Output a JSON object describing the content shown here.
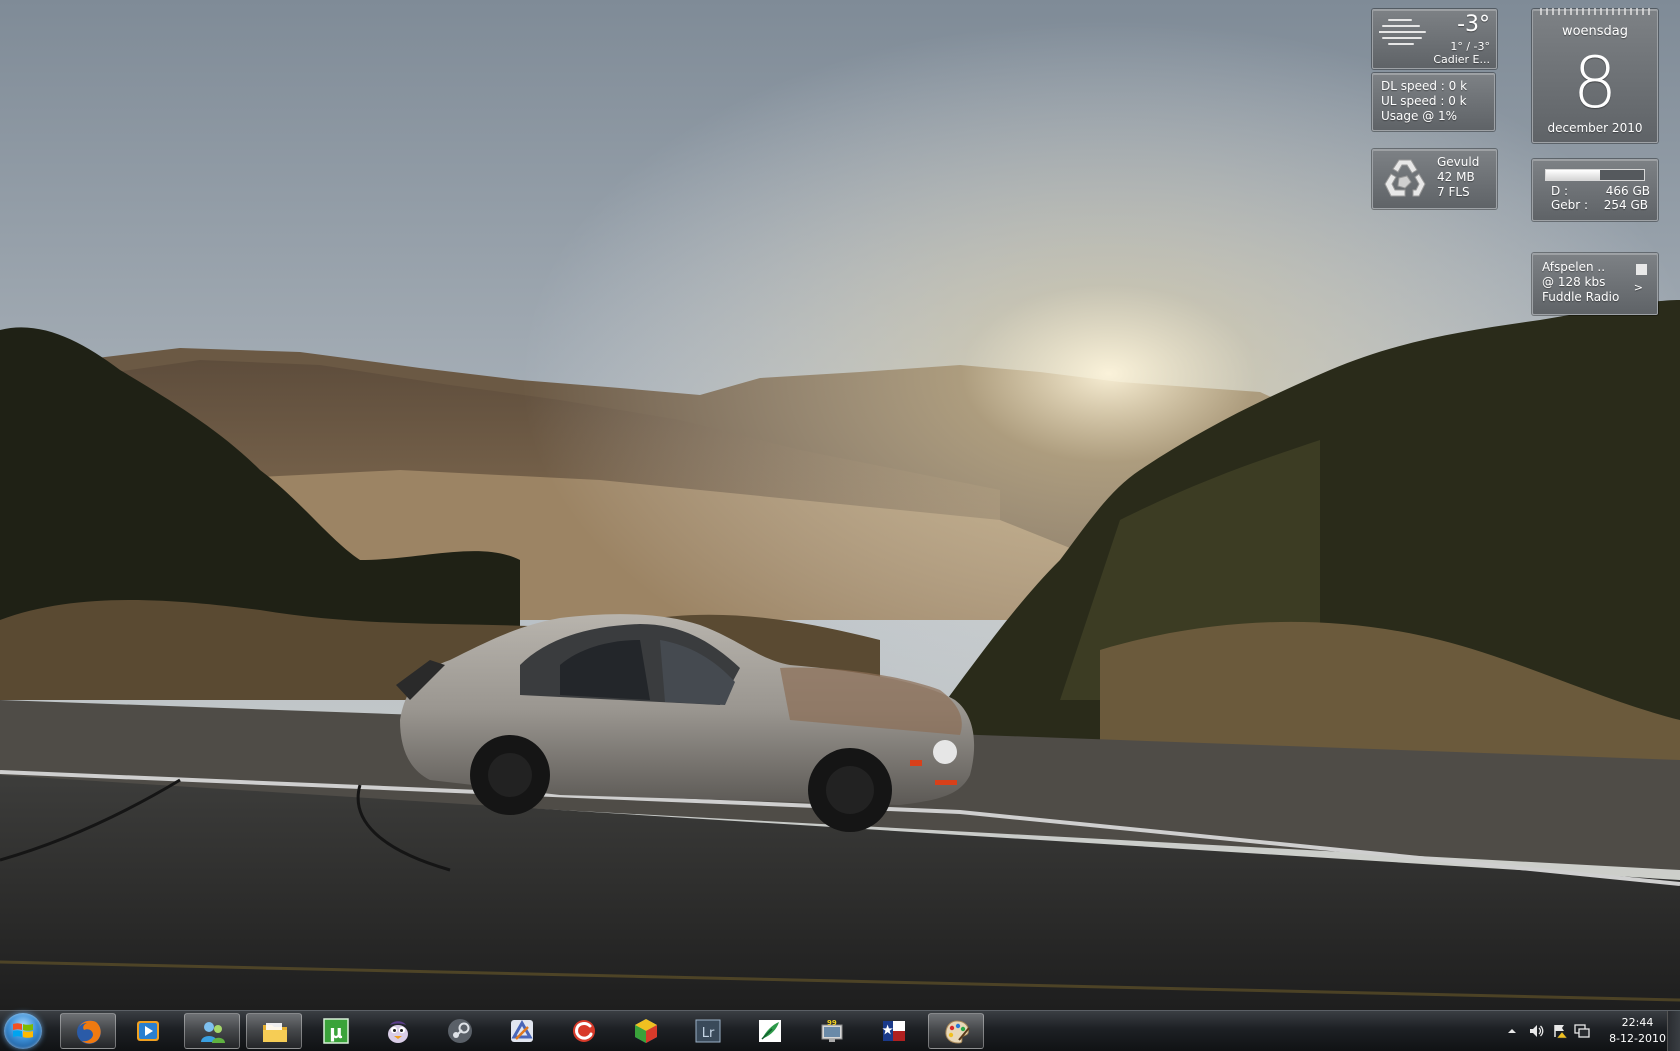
{
  "weather": {
    "temperature": "-3°",
    "range": "1° / -3°",
    "city": "Cadier E..."
  },
  "network": {
    "dl": "DL speed : 0 k",
    "ul": "UL speed : 0 k",
    "usage": "Usage @ 1%"
  },
  "recycle_bin": {
    "status": "Gevuld",
    "size": "42 MB",
    "files": "7 FLS"
  },
  "calendar": {
    "day_name": "woensdag",
    "day_number": "8",
    "month_year": "december 2010"
  },
  "drive": {
    "usage_fraction": 0.55,
    "total_label": "D :",
    "total_value": "466 GB",
    "used_label": "Gebr :",
    "used_value": "254 GB"
  },
  "radio": {
    "status": "Afspelen ..",
    "bitrate": "@ 128 kbs",
    "station": "Fuddle Radio",
    "next_symbol": ">"
  },
  "taskbar": {
    "pinned": [
      {
        "name": "firefox-icon",
        "color": "#e66000",
        "active": true
      },
      {
        "name": "media-player-icon",
        "color": "#f0a020",
        "active": false
      },
      {
        "name": "messenger-icon",
        "color": "#3aa0e0",
        "active": true
      },
      {
        "name": "explorer-folder-icon",
        "color": "#f0c040",
        "active": true
      },
      {
        "name": "utorrent-icon",
        "color": "#3aa33a",
        "active": false
      },
      {
        "name": "pidgin-icon",
        "color": "#8a6fb0",
        "active": false
      },
      {
        "name": "steam-icon",
        "color": "#9aa0a8",
        "active": false
      },
      {
        "name": "visual-studio-icon",
        "color": "#6a88c8",
        "active": false
      },
      {
        "name": "ccleaner-icon",
        "color": "#d83a2a",
        "active": false
      },
      {
        "name": "virtualbox-icon",
        "color": "#3d7dd8",
        "active": false
      },
      {
        "name": "lightroom-icon",
        "color": "#6e8aa6",
        "active": false
      },
      {
        "name": "feather-app-icon",
        "color": "#2e9a4a",
        "active": false
      },
      {
        "name": "rdp-monitor-icon",
        "color": "#c8c8c8",
        "active": false
      },
      {
        "name": "star-flag-icon",
        "color": "#b02020",
        "active": false
      },
      {
        "name": "paint-icon",
        "color": "#d8a050",
        "active": true
      }
    ],
    "utorrent_glyph": "µ",
    "lightroom_text": "Lr",
    "rdp_badge": "99",
    "clock_time": "22:44",
    "clock_date": "8-12-2010"
  }
}
